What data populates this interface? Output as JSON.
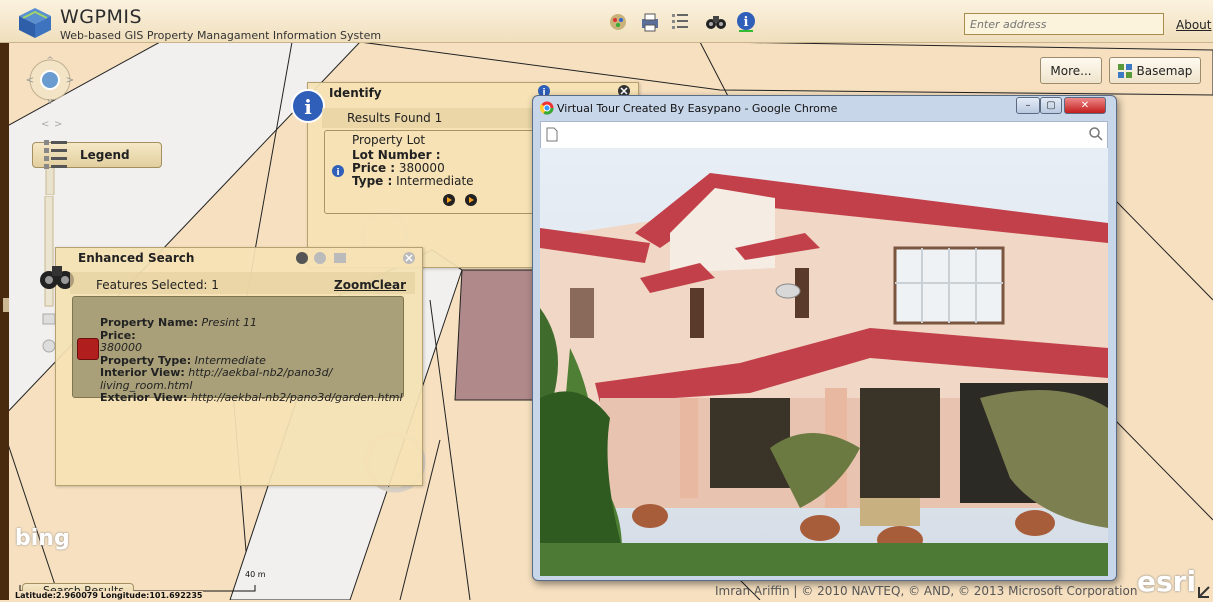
{
  "app": {
    "title": "WGPMIS",
    "subtitle": "Web-based GIS Property Managament Information System"
  },
  "toolbar": {
    "icons": [
      "tools-icon",
      "print-icon",
      "list-icon",
      "search-binoculars-icon",
      "info-icon"
    ]
  },
  "header": {
    "address_placeholder": "Enter address",
    "about_label": "About"
  },
  "map_controls": {
    "more_label": "More...",
    "basemap_label": "Basemap",
    "legend_label": "Legend",
    "search_results_label": "Search Results"
  },
  "identify": {
    "title": "Identify",
    "results_found": "Results Found 1",
    "layer_name": "Property Lot",
    "fields": [
      {
        "label": "Lot Number :",
        "value": ""
      },
      {
        "label": "Price :",
        "value": "380000"
      },
      {
        "label": "Type :",
        "value": "Intermediate"
      }
    ]
  },
  "enhanced_search": {
    "title": "Enhanced Search",
    "features_selected": "Features Selected: 1",
    "zoom_label": "Zoom",
    "clear_label": "Clear",
    "result": {
      "property_name_label": "Property Name:",
      "property_name_value": "Presint 11",
      "price_label": "Price:",
      "price_value": "380000",
      "property_type_label": "Property Type:",
      "property_type_value": "Intermediate",
      "interior_label": "Interior View:",
      "interior_value_1": "http://aekbal-nb2/pano3d/",
      "interior_value_2": "living_room.html",
      "exterior_label": "Exterior View:",
      "exterior_value": "http://aekbal-nb2/pano3d/garden.html"
    }
  },
  "browser": {
    "title": "Virtual Tour Created By Easypano - Google Chrome"
  },
  "footer": {
    "attribution": "Imran Ariffin | © 2010 NAVTEQ, © AND, © 2013 Microsoft Corporation",
    "coordinates": "Latitude:2.960079  Longitude:101.692235",
    "scale": "40 m",
    "bing_logo": "bing",
    "esri_logo": "esri"
  },
  "colors": {
    "map_background": "#f6e0c0",
    "panel_background": "#f5e2b4",
    "highlight_parcel": "#b08a8a",
    "selected_marker": "#b01e1e"
  }
}
